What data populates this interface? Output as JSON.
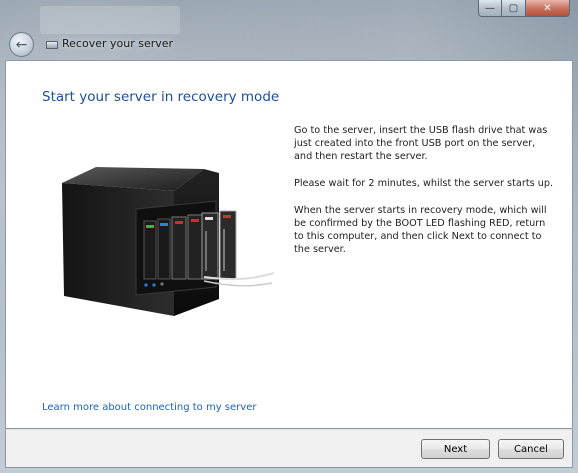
{
  "window": {
    "title": "Recover your server",
    "caption": {
      "minimize_glyph": "—",
      "maximize_glyph": "▢",
      "close_glyph": "✕"
    }
  },
  "nav": {
    "back_glyph": "←"
  },
  "content": {
    "heading": "Start your server in recovery mode",
    "instructions": [
      "Go to the server, insert the USB flash drive that was just created into the front USB port on the server, and then restart the server.",
      "Please wait for 2 minutes, whilst the server starts up.",
      "When the server starts in recovery mode, which will be confirmed by the BOOT LED flashing RED, return to this computer, and then click Next to connect to the server."
    ],
    "learn_more_link": "Learn more about connecting to my server",
    "image": {
      "name": "server-hardware-illustration"
    }
  },
  "footer": {
    "next_label": "Next",
    "cancel_label": "Cancel"
  },
  "colors": {
    "heading": "#1b4f97",
    "link": "#1a63b8",
    "close_button": "#c97462"
  }
}
